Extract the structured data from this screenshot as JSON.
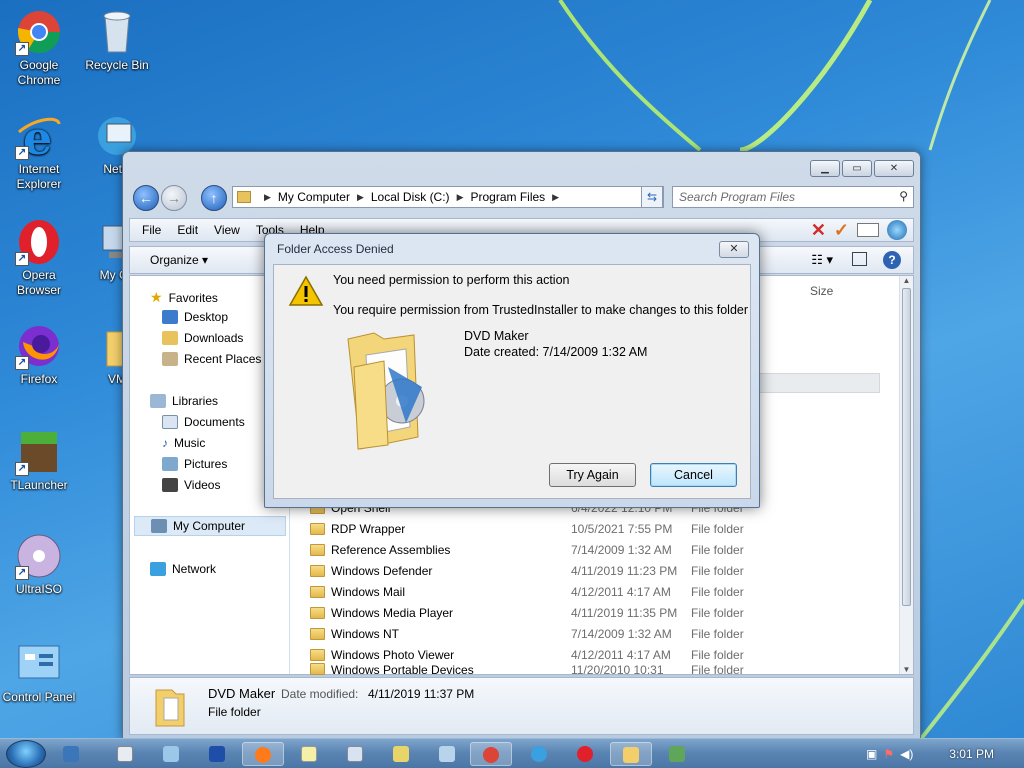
{
  "desktop": {
    "icons": [
      {
        "label": "Google Chrome"
      },
      {
        "label": "Recycle Bin"
      },
      {
        "label": "Internet Explorer"
      },
      {
        "label": "Netw"
      },
      {
        "label": "Opera Browser"
      },
      {
        "label": "My Co"
      },
      {
        "label": "Firefox"
      },
      {
        "label": "VM"
      },
      {
        "label": "TLauncher"
      },
      {
        "label": "UltraISO"
      },
      {
        "label": "Control Panel"
      }
    ]
  },
  "explorer": {
    "breadcrumb": [
      "My Computer",
      "Local Disk (C:)",
      "Program Files"
    ],
    "search_placeholder": "Search Program Files",
    "menu": [
      "File",
      "Edit",
      "View",
      "Tools",
      "Help"
    ],
    "organize_label": "Organize",
    "column_size": "Size",
    "nav": {
      "favorites": "Favorites",
      "desktop": "Desktop",
      "downloads": "Downloads",
      "recent": "Recent Places",
      "libraries": "Libraries",
      "documents": "Documents",
      "music": "Music",
      "pictures": "Pictures",
      "videos": "Videos",
      "computer": "My Computer",
      "network": "Network"
    },
    "files": [
      {
        "name": "Open Shell",
        "date": "6/4/2022 12:10 PM",
        "type": "File folder"
      },
      {
        "name": "RDP Wrapper",
        "date": "10/5/2021 7:55 PM",
        "type": "File folder"
      },
      {
        "name": "Reference Assemblies",
        "date": "7/14/2009 1:32 AM",
        "type": "File folder"
      },
      {
        "name": "Windows Defender",
        "date": "4/11/2019 11:23 PM",
        "type": "File folder"
      },
      {
        "name": "Windows Mail",
        "date": "4/12/2011 4:17 AM",
        "type": "File folder"
      },
      {
        "name": "Windows Media Player",
        "date": "4/11/2019 11:35 PM",
        "type": "File folder"
      },
      {
        "name": "Windows NT",
        "date": "7/14/2009 1:32 AM",
        "type": "File folder"
      },
      {
        "name": "Windows Photo Viewer",
        "date": "4/12/2011 4:17 AM",
        "type": "File folder"
      },
      {
        "name": "Windows Portable Devices",
        "date": "11/20/2010 10:31",
        "type": "File folder"
      }
    ],
    "details": {
      "name": "DVD Maker",
      "modified_label": "Date modified:",
      "modified_value": "4/11/2019 11:37 PM",
      "type": "File folder"
    }
  },
  "dialog": {
    "title": "Folder Access Denied",
    "main": "You need permission to perform this action",
    "sub": "You require permission from TrustedInstaller to make changes to this folder",
    "item_name": "DVD Maker",
    "item_date": "Date created: 7/14/2009 1:32 AM",
    "try_again": "Try Again",
    "cancel": "Cancel"
  },
  "taskbar": {
    "clock": "3:01 PM"
  },
  "colors": {
    "accent": "#2f8ad8",
    "folder": "#e8c25c",
    "warning": "#f5c400"
  }
}
